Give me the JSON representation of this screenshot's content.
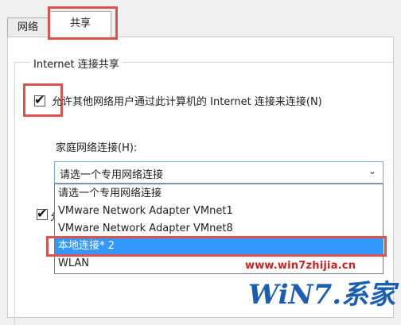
{
  "tabs": [
    {
      "label": "网络"
    },
    {
      "label": "共享"
    }
  ],
  "group": {
    "title": "Internet 连接共享"
  },
  "allow_sharing": {
    "checked": true,
    "label": "允许其他网络用户通过此计算机的 Internet 连接来连接(N)"
  },
  "second_checkbox": {
    "checked": true,
    "label_partial": "允"
  },
  "home_network": {
    "label": "家庭网络连接(H):",
    "selected_value": "请选一个专用网络连接",
    "options": [
      "请选一个专用网络连接",
      "VMware Network Adapter VMnet1",
      "VMware Network Adapter VMnet8",
      "本地连接* 2",
      "WLAN"
    ],
    "highlighted_option_index": 3
  },
  "watermark": {
    "url": "www.win7zhijia.cn",
    "logo_text": "WiN7.系家"
  },
  "icons": {
    "checkmark": "checkmark-icon",
    "dropdown": "chevron-down-icon"
  },
  "colors": {
    "highlight_box": "#d9534f",
    "selection": "#3399ff",
    "watermark_url": "#d11e1e",
    "logo": "#1a5eb3"
  }
}
